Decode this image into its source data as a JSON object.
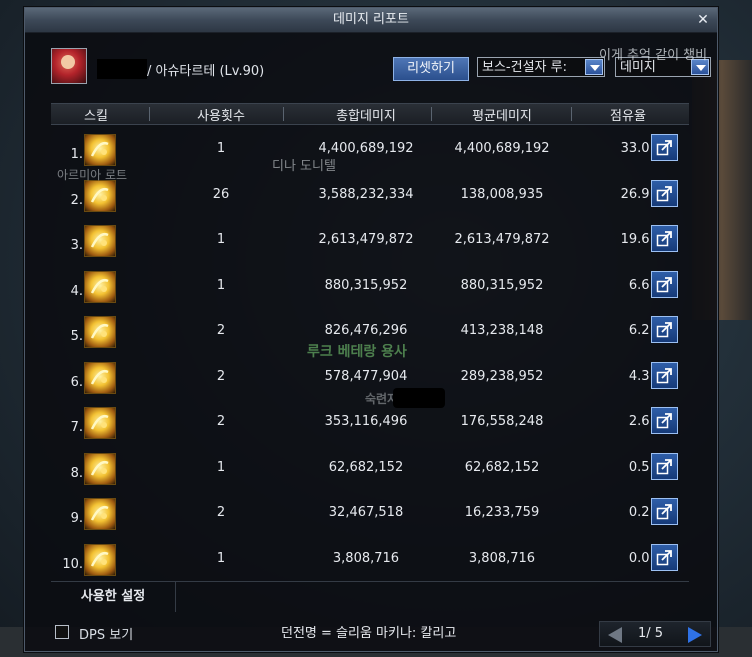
{
  "window": {
    "title": "데미지 리포트"
  },
  "character": {
    "name_suffix": "/ 아슈타르테 (Lv.90)"
  },
  "controls": {
    "reset_label": "리셋하기",
    "boss_select_value": "보스-건설자 루:",
    "type_select_value": "데미지"
  },
  "table": {
    "headers": {
      "skill": "스킬",
      "uses": "사용횟수",
      "total": "총합데미지",
      "avg": "평균데미지",
      "share": "점유율"
    },
    "rows": [
      {
        "rank": "1.",
        "uses": "1",
        "total": "4,400,689,192",
        "avg": "4,400,689,192",
        "share": "33.0 %"
      },
      {
        "rank": "2.",
        "uses": "26",
        "total": "3,588,232,334",
        "avg": "138,008,935",
        "share": "26.9 %"
      },
      {
        "rank": "3.",
        "uses": "1",
        "total": "2,613,479,872",
        "avg": "2,613,479,872",
        "share": "19.6 %"
      },
      {
        "rank": "4.",
        "uses": "1",
        "total": "880,315,952",
        "avg": "880,315,952",
        "share": "6.6 %"
      },
      {
        "rank": "5.",
        "uses": "2",
        "total": "826,476,296",
        "avg": "413,238,148",
        "share": "6.2 %"
      },
      {
        "rank": "6.",
        "uses": "2",
        "total": "578,477,904",
        "avg": "289,238,952",
        "share": "4.3 %"
      },
      {
        "rank": "7.",
        "uses": "2",
        "total": "353,116,496",
        "avg": "176,558,248",
        "share": "2.6 %"
      },
      {
        "rank": "8.",
        "uses": "1",
        "total": "62,682,152",
        "avg": "62,682,152",
        "share": "0.5 %"
      },
      {
        "rank": "9.",
        "uses": "2",
        "total": "32,467,518",
        "avg": "16,233,759",
        "share": "0.2 %"
      },
      {
        "rank": "10.",
        "uses": "1",
        "total": "3,808,716",
        "avg": "3,808,716",
        "share": "0.0 %"
      }
    ]
  },
  "settings_tab": {
    "label": "사용한 설정"
  },
  "footer": {
    "dps_label": "DPS 보기",
    "dungeon_info": "던전명 = 슬리움 마키나: 칼리고",
    "page_text": "1/ 5"
  },
  "background_text": {
    "top_right": "이게 추억 같이 챙비",
    "mid_left": "아르미아 로트",
    "npc_name": "디나 도니텔",
    "guild": "루크 베테랑 용사",
    "player": "숙련자"
  },
  "colors": {
    "accent_blue": "#2f72e6",
    "skill_gold": "#f3c233"
  }
}
